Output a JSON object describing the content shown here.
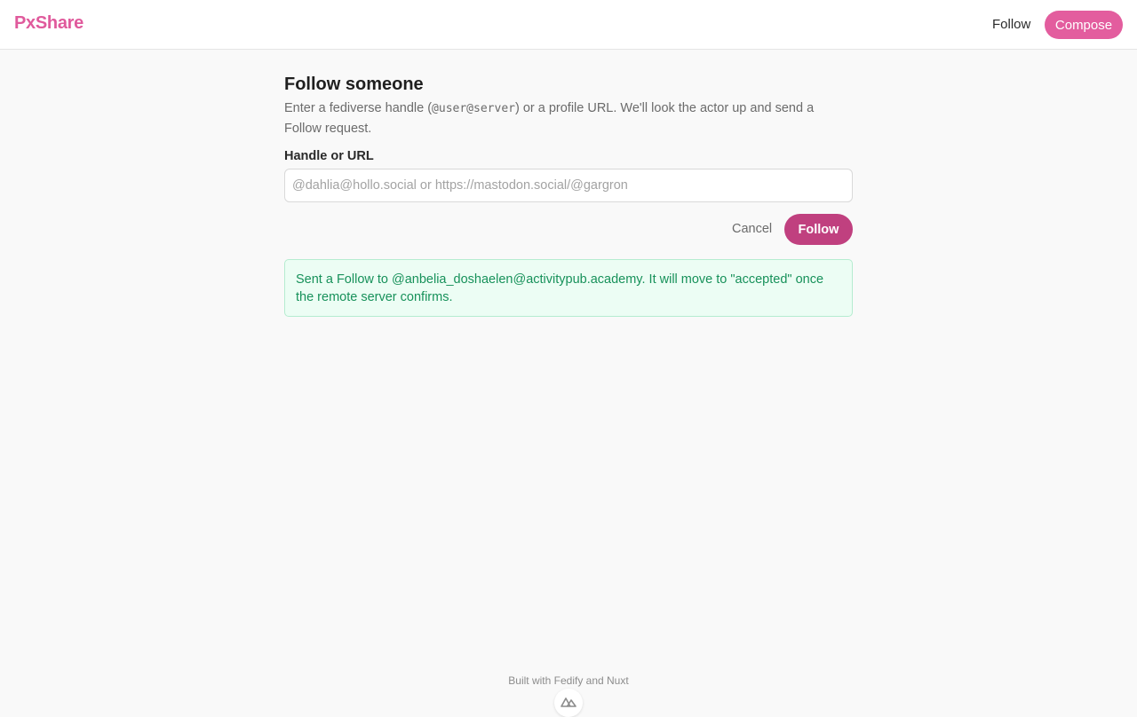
{
  "header": {
    "brand": "PxShare",
    "nav_follow": "Follow",
    "compose_label": "Compose"
  },
  "main": {
    "title": "Follow someone",
    "description_before": "Enter a fediverse handle (",
    "description_code": "@user@server",
    "description_after": ") or a profile URL. We'll look the actor up and send a Follow request.",
    "field_label": "Handle or URL",
    "input_value": "",
    "input_placeholder": "@dahlia@hollo.social or https://mastodon.social/@gargron",
    "cancel_label": "Cancel",
    "follow_label": "Follow",
    "success_message": "Sent a Follow to @anbelia_doshaelen@activitypub.academy. It will move to \"accepted\" once the remote server confirms."
  },
  "footer": {
    "text": "Built with Fedify and Nuxt"
  },
  "colors": {
    "brand": "#e05a9c",
    "compose_bg": "#e35d9e",
    "follow_bg": "#c0407f",
    "success_bg": "#ecfdf4",
    "success_border": "#b5ecd0",
    "success_text": "#17915a"
  },
  "icons": {
    "footer_badge": "nuxt-logo-icon"
  }
}
